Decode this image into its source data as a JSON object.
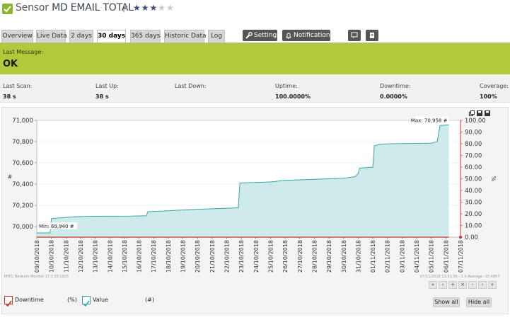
{
  "header": {
    "title_prefix": "Sensor",
    "title": "MD EMAIL TOTAL",
    "stars_on": 3,
    "stars_total": 5,
    "status_color": "#8bb52d"
  },
  "tabs": [
    {
      "label": "Overview"
    },
    {
      "label": "Live Data"
    },
    {
      "label": "2 days"
    },
    {
      "label": "30 days"
    },
    {
      "label": "365 days"
    },
    {
      "label": "Historic Data"
    },
    {
      "label": "Log"
    }
  ],
  "toolbar": {
    "settings_label": "Settings",
    "notifications_label": "Notifications"
  },
  "message": {
    "label": "Last Message:",
    "value": "OK",
    "color": "#b3c83a"
  },
  "stats": [
    {
      "key": "Last Scan:",
      "value": "38 s"
    },
    {
      "key": "Last Up:",
      "value": "38 s"
    },
    {
      "key": "Last Down:",
      "value": ""
    },
    {
      "key": "Uptime:",
      "value": "100.0000%"
    },
    {
      "key": "Downtime:",
      "value": "0.0000%"
    },
    {
      "key": "Coverage:",
      "value": "100%"
    }
  ],
  "legend": [
    {
      "label": "Downtime",
      "unit": "(%)",
      "color": "#c0392b"
    },
    {
      "label": "Value",
      "unit": "(#)",
      "color": "#3aa6a6"
    }
  ],
  "buttons": {
    "show_all": "Show all",
    "hide_all": "Hide all"
  },
  "nav_labels": [
    "«",
    "‹",
    "+",
    "×",
    "-",
    "›",
    "»"
  ],
  "footer": {
    "left": "PRTG Network Monitor 17.3.30.1925",
    "right": "07/11/2018 13:51:56 - 1 h Average - ID 4867"
  },
  "chart_data": {
    "type": "area",
    "ylabel": "#",
    "y2label": "%",
    "ylim": [
      69900,
      71000
    ],
    "y2lim": [
      0,
      100
    ],
    "yticks": [
      "70,000",
      "70,200",
      "70,400",
      "70,600",
      "70,800",
      "71,000"
    ],
    "y2ticks": [
      "0.00",
      "10.00",
      "20.00",
      "30.00",
      "40.00",
      "50.00",
      "60.00",
      "70.00",
      "80.00",
      "90.00",
      "100.00"
    ],
    "x": [
      "09/10/2018",
      "10/10/2018",
      "11/10/2018",
      "12/10/2018",
      "13/10/2018",
      "14/10/2018",
      "15/10/2018",
      "16/10/2018",
      "17/10/2018",
      "18/10/2018",
      "19/10/2018",
      "20/10/2018",
      "21/10/2018",
      "22/10/2018",
      "23/10/2018",
      "24/10/2018",
      "25/10/2018",
      "26/10/2018",
      "27/10/2018",
      "28/10/2018",
      "29/10/2018",
      "30/10/2018",
      "31/10/2018",
      "01/11/2018",
      "02/11/2018",
      "03/11/2018",
      "04/11/2018",
      "05/11/2018",
      "06/11/2018",
      "07/11/2018"
    ],
    "series": [
      {
        "name": "Value",
        "color": "#3aa6a6",
        "values": [
          [
            0,
            69940
          ],
          [
            0.9,
            69940
          ],
          [
            1.0,
            70075
          ],
          [
            1.9,
            70085
          ],
          [
            2.6,
            70093
          ],
          [
            3.5,
            70096
          ],
          [
            4.5,
            70097
          ],
          [
            6.5,
            70098
          ],
          [
            7.5,
            70102
          ],
          [
            7.6,
            70140
          ],
          [
            8.5,
            70145
          ],
          [
            10.5,
            70160
          ],
          [
            12.5,
            70170
          ],
          [
            13.5,
            70175
          ],
          [
            13.8,
            70180
          ],
          [
            13.9,
            70410
          ],
          [
            16,
            70420
          ],
          [
            17,
            70435
          ],
          [
            19,
            70445
          ],
          [
            21,
            70455
          ],
          [
            21.8,
            70470
          ],
          [
            22,
            70500
          ],
          [
            22.1,
            70550
          ],
          [
            23,
            70560
          ],
          [
            23.1,
            70760
          ],
          [
            23.5,
            70775
          ],
          [
            24.3,
            70780
          ],
          [
            27,
            70785
          ],
          [
            27.4,
            70800
          ],
          [
            27.6,
            70950
          ],
          [
            28.2,
            70958
          ]
        ]
      },
      {
        "name": "Downtime",
        "color": "#c0392b",
        "values": [
          [
            0,
            0
          ],
          [
            28.2,
            0
          ]
        ]
      }
    ],
    "annotations": [
      {
        "text": "Min: 69,940 #"
      },
      {
        "text": "Max: 70,958 #"
      }
    ]
  }
}
